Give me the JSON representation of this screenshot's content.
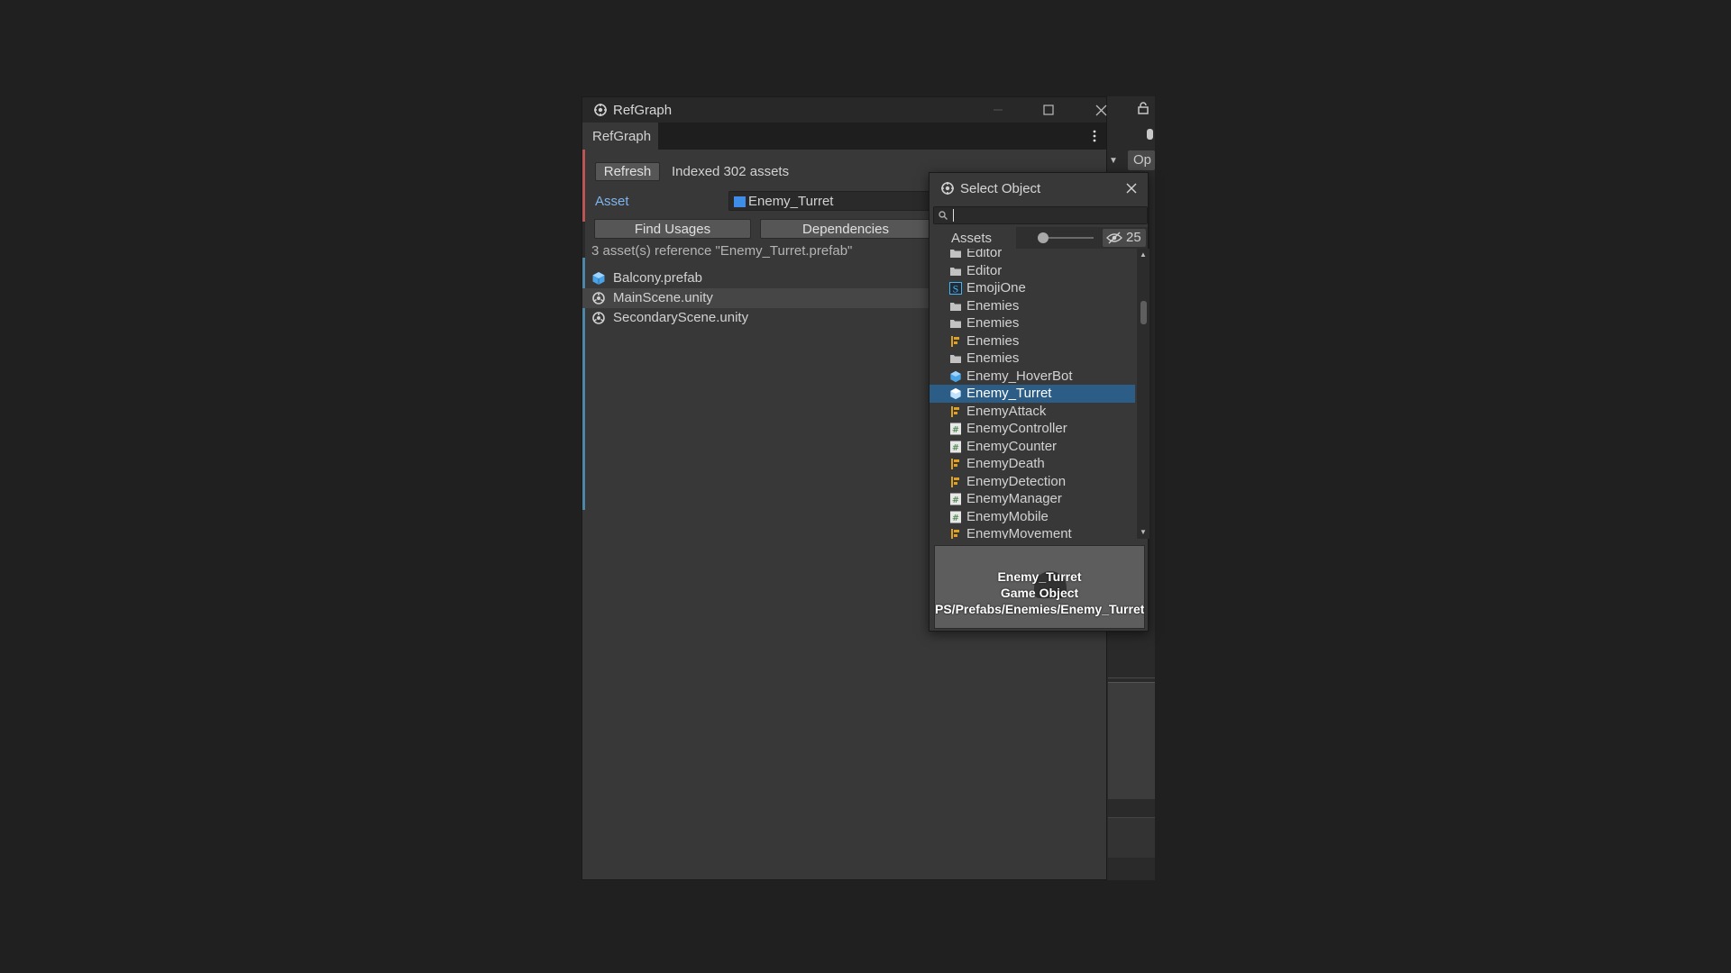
{
  "background_editor": {
    "open_button_label": "Op"
  },
  "window": {
    "title": "RefGraph",
    "tab_label": "RefGraph"
  },
  "toolbar": {
    "refresh_label": "Refresh",
    "indexed_text": "Indexed 302 assets"
  },
  "asset_field": {
    "label": "Asset",
    "value": "Enemy_Turret"
  },
  "actions": {
    "find_usages_label": "Find Usages",
    "dependencies_label": "Dependencies"
  },
  "results": {
    "summary": "3 asset(s) reference \"Enemy_Turret.prefab\"",
    "items": [
      {
        "label": "Balcony.prefab",
        "icon": "prefab-icon"
      },
      {
        "label": "MainScene.unity",
        "icon": "unity-scene-icon"
      },
      {
        "label": "SecondaryScene.unity",
        "icon": "unity-scene-icon"
      }
    ]
  },
  "select_object": {
    "title": "Select Object",
    "search_value": "",
    "tab_label": "Assets",
    "hidden_count": "25",
    "items": [
      {
        "label": "Editor",
        "icon": "folder-icon"
      },
      {
        "label": "Editor",
        "icon": "folder-icon"
      },
      {
        "label": "EmojiOne",
        "icon": "font-asset-icon"
      },
      {
        "label": "Enemies",
        "icon": "folder-icon"
      },
      {
        "label": "Enemies",
        "icon": "folder-icon"
      },
      {
        "label": "Enemies",
        "icon": "animator-icon"
      },
      {
        "label": "Enemies",
        "icon": "folder-icon"
      },
      {
        "label": "Enemy_HoverBot",
        "icon": "prefab-icon"
      },
      {
        "label": "Enemy_Turret",
        "icon": "prefab-icon"
      },
      {
        "label": "EnemyAttack",
        "icon": "animator-icon"
      },
      {
        "label": "EnemyController",
        "icon": "script-icon"
      },
      {
        "label": "EnemyCounter",
        "icon": "script-icon"
      },
      {
        "label": "EnemyDeath",
        "icon": "animator-icon"
      },
      {
        "label": "EnemyDetection",
        "icon": "animator-icon"
      },
      {
        "label": "EnemyManager",
        "icon": "script-icon"
      },
      {
        "label": "EnemyMobile",
        "icon": "script-icon"
      },
      {
        "label": "EnemyMovement",
        "icon": "animator-icon"
      }
    ],
    "selected_index": 8,
    "preview": {
      "name": "Enemy_Turret",
      "type": "Game Object",
      "path": "PS/Prefabs/Enemies/Enemy_Turret"
    }
  },
  "colors": {
    "selection": "#2c5d87",
    "link_label": "#7fb4ec",
    "prefab": "#3e8ee8"
  }
}
